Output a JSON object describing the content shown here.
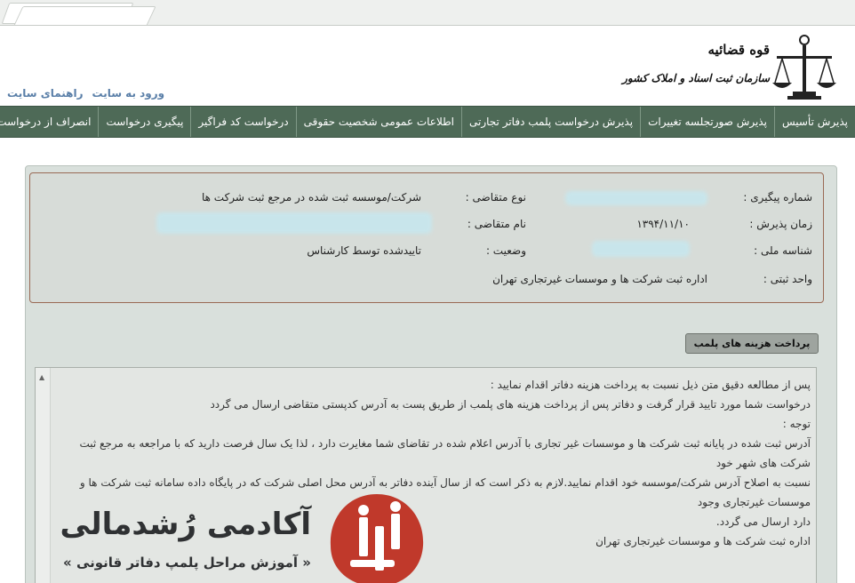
{
  "header": {
    "org_line1": "قوه قضائیه",
    "org_line2": "سازمان ثبت اسناد و املاک کشور",
    "links": {
      "login": "ورود به سایت",
      "guide": "راهنمای سایت"
    }
  },
  "nav": {
    "items": [
      "پذیرش تأسیس",
      "پذیرش صورتجلسه تغییرات",
      "پذیرش درخواست پلمب دفاتر تجارتی",
      "اطلاعات عمومی شخصیت حقوقی",
      "درخواست کد فراگیر",
      "پیگیری درخواست",
      "انصراف از درخواست"
    ]
  },
  "info": {
    "tracking_label": "شماره پیگیری :",
    "request_type_label": "نوع متقاضی :",
    "request_type_value": "شرکت/موسسه ثبت شده در مرجع ثبت شرکت ها",
    "accept_time_label": "زمان پذیرش :",
    "accept_time_value": "۱۳۹۴/۱۱/۱۰",
    "applicant_name_label": "نام متقاضی :",
    "national_id_label": "شناسه ملی :",
    "status_label": "وضعیت :",
    "status_value": "تاییدشده توسط کارشناس",
    "unit_label": "واحد ثبتی :",
    "unit_value": "اداره ثبت شرکت ها و موسسات غیرتجاری تهران"
  },
  "pay_button": "پرداخت هزینه های پلمب",
  "notice": {
    "lines": [
      "پس از مطالعه دقیق متن ذیل نسبت به پرداخت هزینه دفاتر اقدام نمایید :",
      "درخواست شما مورد تایید قرار گرفت و دفاتر پس از پرداخت هزینه های پلمب از طریق پست به آدرس کدپستی متقاضی ارسال می گردد",
      "توجه :",
      "آدرس ثبت شده در پایانه ثبت شرکت ها و موسسات غیر تجاری با آدرس اعلام شده در تقاضای شما مغایرت دارد ، لذا یک سال فرصت دارید که با مراجعه به مرجع ثبت شرکت های شهر خود",
      "نسبت به اصلاح آدرس شرکت/موسسه خود اقدام نمایید.لازم به ذکر است که از سال آینده دفاتر به آدرس محل اصلی شرکت که در پایگاه داده سامانه ثبت شرکت ها و موسسات غیرتجاری وجود",
      "دارد ارسال می گردد.",
      "اداره ثبت شرکت ها و موسسات غیرتجاری تهران"
    ]
  },
  "watermark": {
    "title": "آکادمی رُشدمالی",
    "subtitle": "« آموزش مراحل پلمپ دفاتر قانونی »"
  },
  "colors": {
    "nav_bg": "#4e6a57",
    "link": "#5a7fa8",
    "brand_red": "#c0392b",
    "info_border": "#9a6a55"
  }
}
